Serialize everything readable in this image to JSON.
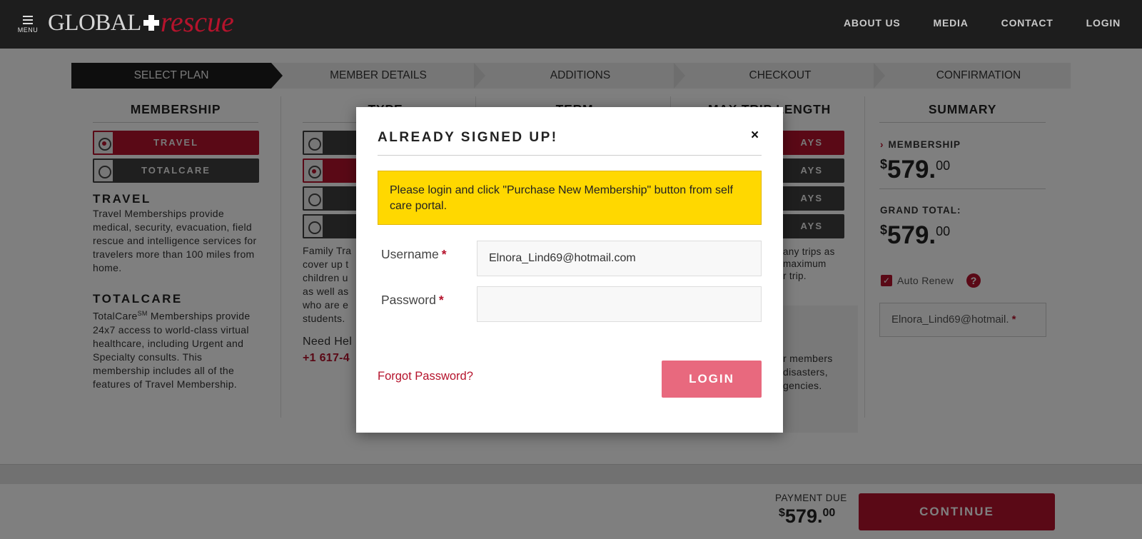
{
  "header": {
    "menu_label": "MENU",
    "logo_global": "GLOBAL",
    "logo_rescue": "rescue",
    "nav": [
      "ABOUT US",
      "MEDIA",
      "CONTACT",
      "LOGIN"
    ]
  },
  "steps": [
    "SELECT PLAN",
    "MEMBER DETAILS",
    "ADDITIONS",
    "CHECKOUT",
    "CONFIRMATION"
  ],
  "membership": {
    "title": "MEMBERSHIP",
    "options": [
      "TRAVEL",
      "TOTALCARE"
    ],
    "selected": "TRAVEL",
    "travel_heading": "TRAVEL",
    "travel_text": "Travel Memberships provide medical, security, evacuation, field rescue and intelligence services for travelers more than 100 miles from home.",
    "totalcare_heading": "TOTALCARE",
    "totalcare_text_a": "TotalCare",
    "totalcare_sm": "SM",
    "totalcare_text_b": " Memberships provide 24x7 access to world-class virtual healthcare, including Urgent and Specialty consults. This membership includes all of the features of Travel Membership."
  },
  "type_col": {
    "title": "TYPE",
    "text_lines": [
      "Family Tra",
      "cover up t",
      "children u",
      "as well as",
      "who are e",
      "students."
    ],
    "need_help": "Need Hel",
    "phone": "+1 617-4"
  },
  "term_col": {
    "title": "TERM"
  },
  "trip_col": {
    "title": "MAX TRIP LENGTH",
    "options": [
      "AYS",
      "AYS",
      "AYS",
      "AYS"
    ],
    "text_lines": [
      "any trips as",
      "maximum",
      "r trip."
    ],
    "text2_lines": [
      "r members",
      "disasters,",
      "gencies."
    ]
  },
  "summary": {
    "title": "SUMMARY",
    "membership_label": "MEMBERSHIP",
    "membership_dollar": "$",
    "membership_price": "579.",
    "membership_cents": "00",
    "grand_total_label": "GRAND TOTAL:",
    "grand_dollar": "$",
    "grand_price": "579.",
    "grand_cents": "00",
    "auto_renew": "Auto Renew",
    "email": "Elnora_Lind69@hotmail."
  },
  "footer": {
    "payment_due": "PAYMENT DUE",
    "dollar": "$",
    "amount": "579.",
    "cents": "00",
    "continue": "CONTINUE"
  },
  "modal": {
    "title": "ALREADY SIGNED UP!",
    "close": "×",
    "alert": "Please login and click \"Purchase New Membership\" button from self care portal.",
    "username_label": "Username",
    "username_value": "Elnora_Lind69@hotmail.com",
    "password_label": "Password",
    "password_value": "",
    "required_mark": "*",
    "forgot": "Forgot Password?",
    "login": "LOGIN"
  },
  "colors": {
    "brand_red": "#b5132c",
    "login_button": "#e8697e",
    "alert_yellow": "#ffd800",
    "header_bg": "#1d1d1d"
  }
}
